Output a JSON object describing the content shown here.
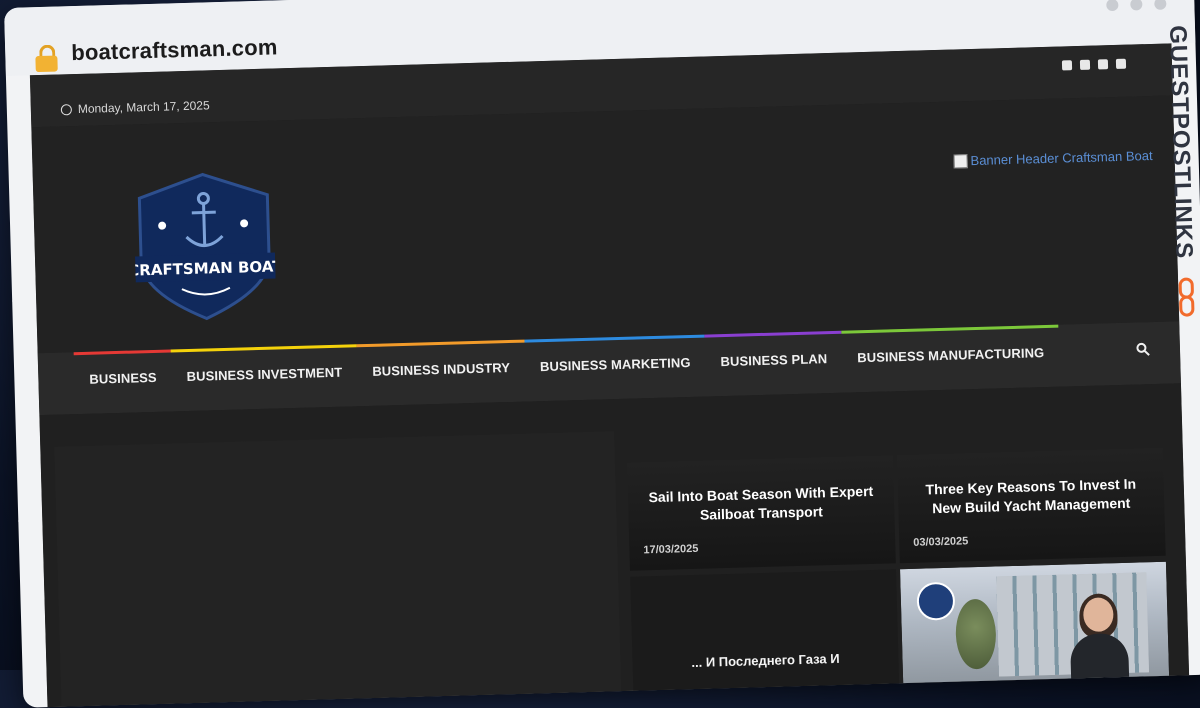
{
  "browser": {
    "url": "boatcraftsman.com"
  },
  "topbar": {
    "date": "Monday, March 17, 2025",
    "social_icons": [
      "facebook-icon",
      "twitter-icon",
      "instagram-icon",
      "pinterest-icon"
    ]
  },
  "header": {
    "logo_text": "CRAFTSMAN BOAT",
    "banner_alt": "Banner Header Craftsman Boat"
  },
  "nav": {
    "items": [
      {
        "label": "BUSINESS",
        "color": "#e53935"
      },
      {
        "label": "BUSINESS INVESTMENT",
        "color": "#f4d20b"
      },
      {
        "label": "BUSINESS INDUSTRY",
        "color": "#f29b2a"
      },
      {
        "label": "BUSINESS MARKETING",
        "color": "#2d8be0"
      },
      {
        "label": "BUSINESS PLAN",
        "color": "#8a3fd1"
      },
      {
        "label": "BUSINESS MANUFACTURING",
        "color": "#7cc83a"
      }
    ]
  },
  "cards": [
    {
      "title": "Sail Into Boat Season With Expert Sailboat Transport",
      "date": "17/03/2025"
    },
    {
      "title": "Three Key Reasons To Invest In New Build Yacht Management",
      "date": "03/03/2025"
    },
    {
      "title": "... И Последнего Газа И",
      "date": ""
    }
  ],
  "watermark": {
    "text": "GUESTPOSTLINKS",
    "color": "#2f3440",
    "accent": "#f26b2c"
  }
}
